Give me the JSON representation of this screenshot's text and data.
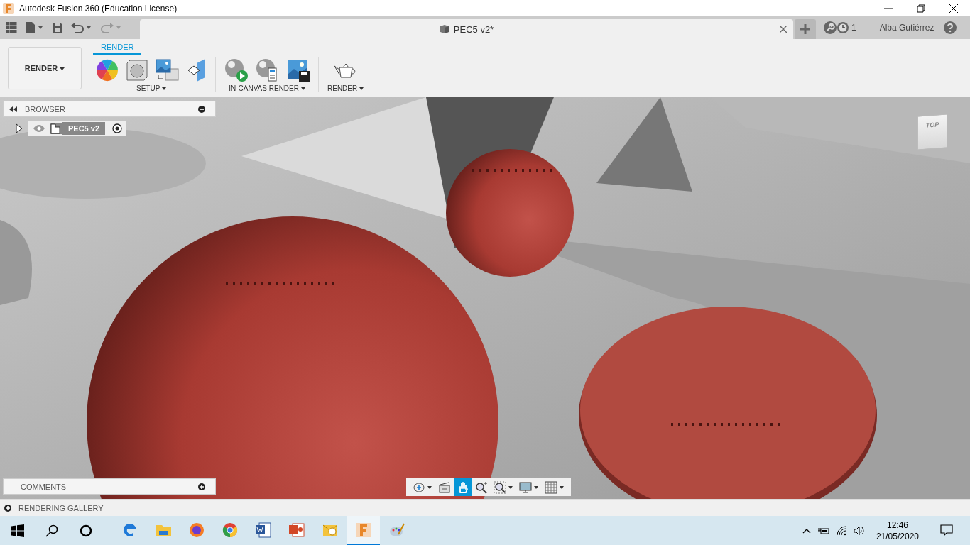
{
  "window": {
    "title": "Autodesk Fusion 360 (Education License)"
  },
  "document_tab": {
    "title": "PEC5 v2*"
  },
  "header": {
    "jobs_count": "1",
    "user": "Alba Gutiérrez"
  },
  "workspace": {
    "label": "RENDER"
  },
  "ribbon_tabs": [
    {
      "label": "RENDER",
      "selected": true
    }
  ],
  "ribbon_groups": [
    {
      "label": "SETUP",
      "kind": "setup"
    },
    {
      "label": "IN-CANVAS RENDER",
      "kind": "incanvas"
    },
    {
      "label": "RENDER",
      "kind": "render"
    }
  ],
  "browser": {
    "title": "BROWSER",
    "items": [
      {
        "label": "PEC5 v2",
        "expanded": false
      }
    ]
  },
  "view_cube": {
    "face": "TOP"
  },
  "comments": {
    "title": "COMMENTS"
  },
  "nav_tools": [
    {
      "kind": "orbit",
      "selected": false
    },
    {
      "kind": "look",
      "selected": false
    },
    {
      "kind": "pan",
      "selected": true
    },
    {
      "kind": "zoom",
      "selected": false
    },
    {
      "kind": "fit",
      "selected": false
    },
    {
      "kind": "display",
      "selected": false
    },
    {
      "kind": "grid",
      "selected": false
    }
  ],
  "gallery": {
    "title": "RENDERING GALLERY"
  },
  "taskbar": {
    "apps": [
      {
        "kind": "edge",
        "selected": false
      },
      {
        "kind": "explorer",
        "selected": false
      },
      {
        "kind": "firefox",
        "selected": false
      },
      {
        "kind": "chrome",
        "selected": false
      },
      {
        "kind": "word",
        "selected": false
      },
      {
        "kind": "powerpoint",
        "selected": false
      },
      {
        "kind": "outlook",
        "selected": false
      },
      {
        "kind": "fusion",
        "selected": true
      },
      {
        "kind": "paint",
        "selected": false
      }
    ],
    "time": "12:46",
    "date": "21/05/2020"
  }
}
